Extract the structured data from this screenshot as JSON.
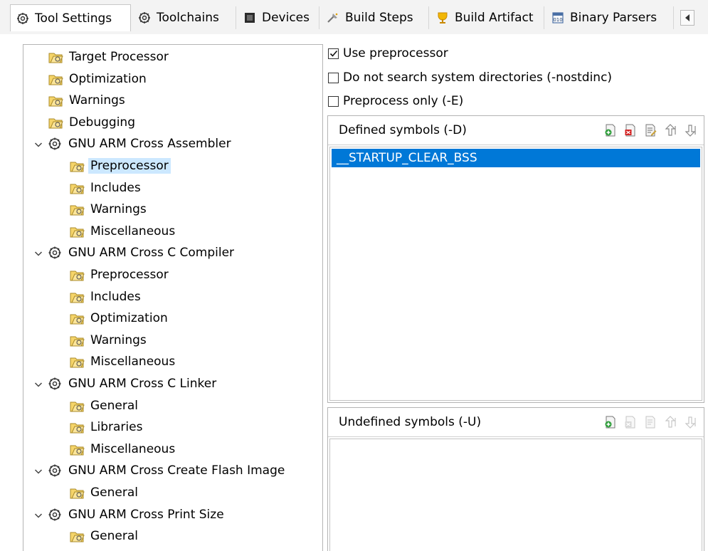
{
  "tabs": [
    {
      "label": "Tool Settings",
      "icon": "gear-icon",
      "active": true
    },
    {
      "label": "Toolchains",
      "icon": "gear-icon",
      "active": false
    },
    {
      "label": "Devices",
      "icon": "chip-icon",
      "active": false
    },
    {
      "label": "Build Steps",
      "icon": "build-steps-icon",
      "active": false
    },
    {
      "label": "Build Artifact",
      "icon": "artifact-icon",
      "active": false
    },
    {
      "label": "Binary Parsers",
      "icon": "binary-icon",
      "active": false
    }
  ],
  "tree": [
    {
      "label": "Target Processor",
      "level": 1,
      "expandable": false,
      "icon": "option-icon"
    },
    {
      "label": "Optimization",
      "level": 1,
      "expandable": false,
      "icon": "option-icon"
    },
    {
      "label": "Warnings",
      "level": 1,
      "expandable": false,
      "icon": "option-icon"
    },
    {
      "label": "Debugging",
      "level": 1,
      "expandable": false,
      "icon": "option-icon"
    },
    {
      "label": "GNU ARM Cross Assembler",
      "level": 0,
      "expandable": true,
      "icon": "tool-icon"
    },
    {
      "label": "Preprocessor",
      "level": 2,
      "expandable": false,
      "icon": "option-icon",
      "selected": true
    },
    {
      "label": "Includes",
      "level": 2,
      "expandable": false,
      "icon": "option-icon"
    },
    {
      "label": "Warnings",
      "level": 2,
      "expandable": false,
      "icon": "option-icon"
    },
    {
      "label": "Miscellaneous",
      "level": 2,
      "expandable": false,
      "icon": "option-icon"
    },
    {
      "label": "GNU ARM Cross C Compiler",
      "level": 0,
      "expandable": true,
      "icon": "tool-icon"
    },
    {
      "label": "Preprocessor",
      "level": 2,
      "expandable": false,
      "icon": "option-icon"
    },
    {
      "label": "Includes",
      "level": 2,
      "expandable": false,
      "icon": "option-icon"
    },
    {
      "label": "Optimization",
      "level": 2,
      "expandable": false,
      "icon": "option-icon"
    },
    {
      "label": "Warnings",
      "level": 2,
      "expandable": false,
      "icon": "option-icon"
    },
    {
      "label": "Miscellaneous",
      "level": 2,
      "expandable": false,
      "icon": "option-icon"
    },
    {
      "label": "GNU ARM Cross C Linker",
      "level": 0,
      "expandable": true,
      "icon": "tool-icon"
    },
    {
      "label": "General",
      "level": 2,
      "expandable": false,
      "icon": "option-icon"
    },
    {
      "label": "Libraries",
      "level": 2,
      "expandable": false,
      "icon": "option-icon"
    },
    {
      "label": "Miscellaneous",
      "level": 2,
      "expandable": false,
      "icon": "option-icon"
    },
    {
      "label": "GNU ARM Cross Create Flash Image",
      "level": 0,
      "expandable": true,
      "icon": "tool-icon"
    },
    {
      "label": "General",
      "level": 2,
      "expandable": false,
      "icon": "option-icon"
    },
    {
      "label": "GNU ARM Cross Print Size",
      "level": 0,
      "expandable": true,
      "icon": "tool-icon"
    },
    {
      "label": "General",
      "level": 2,
      "expandable": false,
      "icon": "option-icon"
    }
  ],
  "options": {
    "use_preprocessor": {
      "label": "Use preprocessor",
      "checked": true
    },
    "nostdinc": {
      "label": "Do not search system directories (-nostdinc)",
      "checked": false
    },
    "preprocess_only": {
      "label": "Preprocess only (-E)",
      "checked": false
    }
  },
  "defined_symbols": {
    "title": "Defined symbols (-D)",
    "items": [
      "__STARTUP_CLEAR_BSS"
    ],
    "toolbar": [
      "add-icon",
      "delete-icon",
      "edit-icon",
      "move-up-icon",
      "move-down-icon"
    ]
  },
  "undefined_symbols": {
    "title": "Undefined symbols (-U)",
    "items": [],
    "toolbar": [
      "add-icon",
      "delete-icon",
      "edit-icon",
      "move-up-icon",
      "move-down-icon"
    ]
  },
  "colors": {
    "selection": "#0078d7",
    "tree_selection": "#cce8ff",
    "tab_bar": "#f3f3f3"
  }
}
